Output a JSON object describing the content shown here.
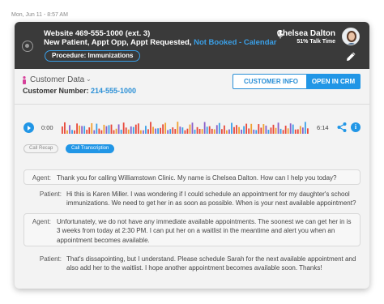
{
  "timestamp": "Mon, Jun 11 - 8:57 AM",
  "header": {
    "line1": "Website 469-555-1000 (ext. 3)",
    "line2_prefix": "New Patient, Appt Opp, Appt Requested, ",
    "line2_status": "Not Booked - Calendar",
    "procedure": "Procedure: Immunizations",
    "agent_name": "Chelsea Dalton",
    "talk_time": "51% Talk Time"
  },
  "customer": {
    "title": "Customer Data",
    "number_label": "Customer Number: ",
    "number": "214-555-1000",
    "info_button": "CUSTOMER INFO",
    "crm_button": "OPEN IN CRM"
  },
  "player": {
    "time_start": "0:00",
    "time_end": "6:14"
  },
  "tabs": {
    "recap": "Call Recap",
    "transcription": "Call Transcription"
  },
  "transcript": [
    {
      "speaker": "Agent:",
      "text": "Thank you for calling Williamstown Clinic. My name is Chelsea Dalton. How can I help you today?"
    },
    {
      "speaker": "Patient:",
      "text": "Hi this is Karen Miller. I was wondering if I could schedule an appointment for my daughter's school immunizations. We need to get her in as soon as possible. When is your next available appointment?"
    },
    {
      "speaker": "Agent:",
      "text": "Unfortunately, we do not have any immediate available appointments. The soonest we can get her in is 3 weeks from today at 2:30 PM. I can put her on a waitlist in the meantime and alert you when an appointment becomes available."
    },
    {
      "speaker": "Patient:",
      "text": "That's dissapointing, but I understand. Please schedule Sarah for the next available appointment and also add her to the waitlist. I hope another appointment becomes available soon. Thanks!"
    }
  ],
  "colors": {
    "accent": "#2196e6",
    "header_bg": "#3a3a3a",
    "wave_red": "#e8483a",
    "wave_orange": "#f0a030",
    "wave_purple": "#8a5fc9",
    "wave_blue": "#3aa0e8"
  }
}
